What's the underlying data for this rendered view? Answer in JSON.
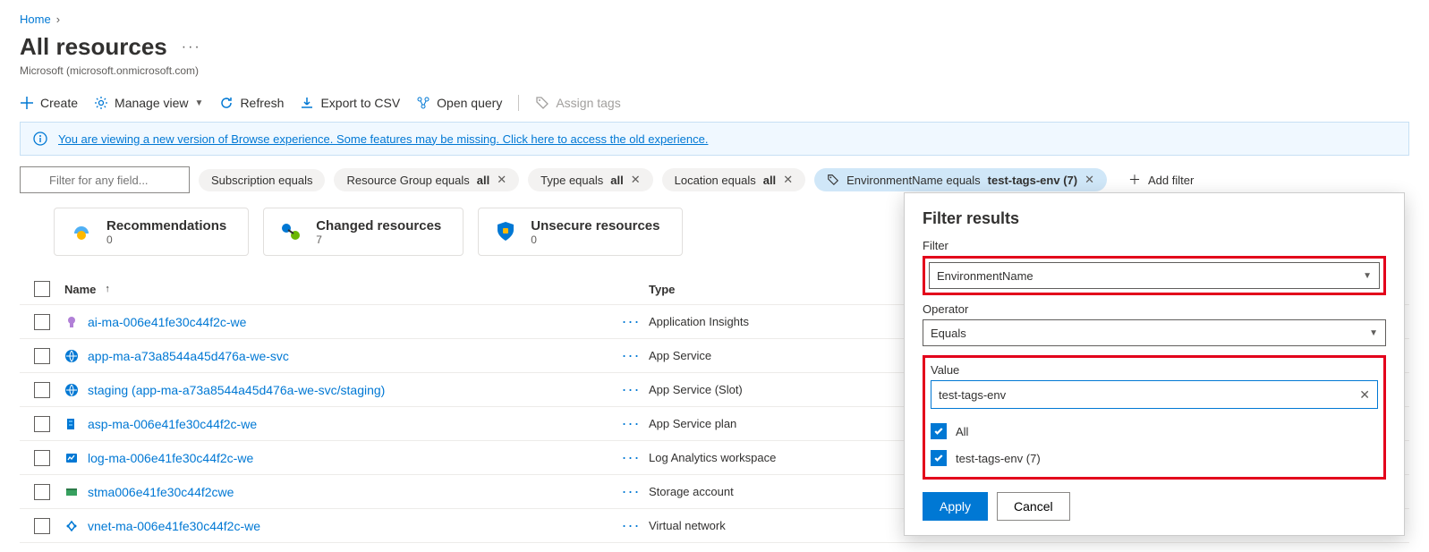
{
  "breadcrumb": {
    "home": "Home"
  },
  "page": {
    "title": "All resources",
    "subtitle": "Microsoft (microsoft.onmicrosoft.com)"
  },
  "toolbar": {
    "create": "Create",
    "manage_view": "Manage view",
    "refresh": "Refresh",
    "export_csv": "Export to CSV",
    "open_query": "Open query",
    "assign_tags": "Assign tags"
  },
  "banner": {
    "text": "You are viewing a new version of Browse experience. Some features may be missing. Click here to access the old experience."
  },
  "filters": {
    "input_placeholder": "Filter for any field...",
    "subscription": "Subscription equals",
    "rg_prefix": "Resource Group equals ",
    "rg_value": "all",
    "type_prefix": "Type equals ",
    "type_value": "all",
    "loc_prefix": "Location equals ",
    "loc_value": "all",
    "env_prefix": "EnvironmentName equals ",
    "env_value": "test-tags-env (7)",
    "add_filter": "Add filter"
  },
  "cards": {
    "rec_title": "Recommendations",
    "rec_val": "0",
    "chg_title": "Changed resources",
    "chg_val": "7",
    "uns_title": "Unsecure resources",
    "uns_val": "0"
  },
  "table": {
    "head_name": "Name",
    "head_type": "Type",
    "rows": [
      {
        "name": "ai-ma-006e41fe30c44f2c-we",
        "type": "Application Insights",
        "icon": "ai"
      },
      {
        "name": "app-ma-a73a8544a45d476a-we-svc",
        "type": "App Service",
        "icon": "app"
      },
      {
        "name": "staging (app-ma-a73a8544a45d476a-we-svc/staging)",
        "type": "App Service (Slot)",
        "icon": "app"
      },
      {
        "name": "asp-ma-006e41fe30c44f2c-we",
        "type": "App Service plan",
        "icon": "plan"
      },
      {
        "name": "log-ma-006e41fe30c44f2c-we",
        "type": "Log Analytics workspace",
        "icon": "log"
      },
      {
        "name": "stma006e41fe30c44f2cwe",
        "type": "Storage account",
        "icon": "stor"
      },
      {
        "name": "vnet-ma-006e41fe30c44f2c-we",
        "type": "Virtual network",
        "icon": "vnet"
      }
    ]
  },
  "popover": {
    "title": "Filter results",
    "filter_label": "Filter",
    "filter_value": "EnvironmentName",
    "operator_label": "Operator",
    "operator_value": "Equals",
    "value_label": "Value",
    "value_input": "test-tags-env",
    "opt_all": "All",
    "opt_env": "test-tags-env (7)",
    "apply": "Apply",
    "cancel": "Cancel"
  }
}
